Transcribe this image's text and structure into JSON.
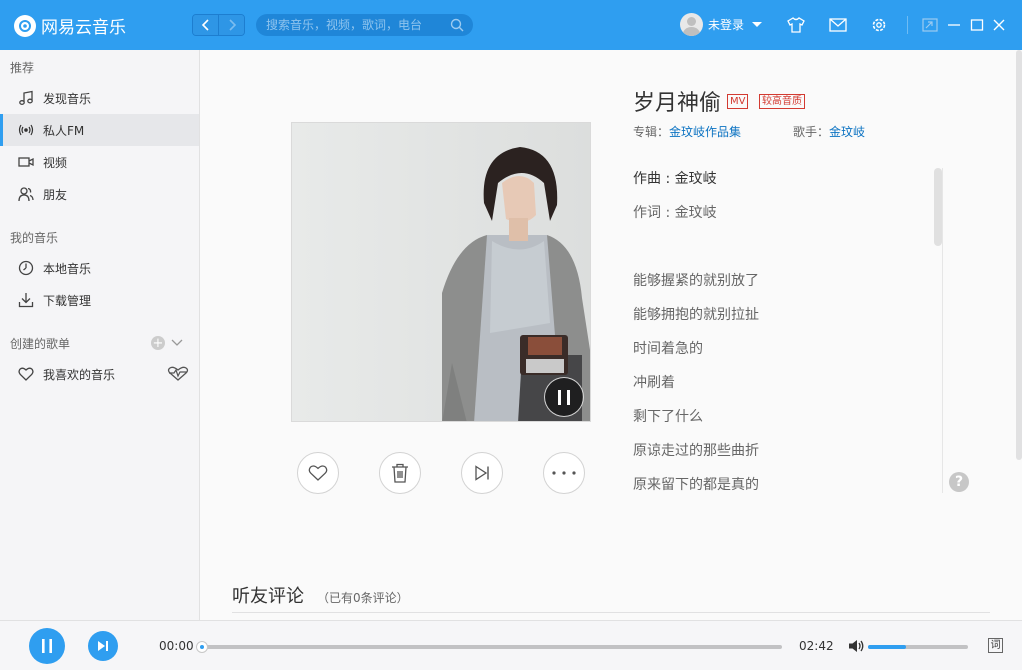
{
  "app": {
    "name": "网易云音乐"
  },
  "search": {
    "placeholder": "搜索音乐，视频，歌词，电台"
  },
  "user": {
    "name": "未登录"
  },
  "sidebar": {
    "section_recommend": "推荐",
    "items_recommend": [
      {
        "label": "发现音乐",
        "icon": "music-note-icon"
      },
      {
        "label": "私人FM",
        "icon": "radio-icon",
        "active": true
      },
      {
        "label": "视频",
        "icon": "video-icon"
      },
      {
        "label": "朋友",
        "icon": "friends-icon"
      }
    ],
    "section_my_music": "我的音乐",
    "items_my_music": [
      {
        "label": "本地音乐",
        "icon": "local-music-icon"
      },
      {
        "label": "下载管理",
        "icon": "download-icon"
      }
    ],
    "section_playlists": "创建的歌单",
    "items_playlists": [
      {
        "label": "我喜欢的音乐",
        "icon": "heart-icon"
      }
    ]
  },
  "song": {
    "title": "岁月神偷",
    "tag_mv": "MV",
    "tag_quality": "较高音质",
    "album_label": "专辑：",
    "album": "金玟岐作品集",
    "artist_label": "歌手：",
    "artist": "金玟岐"
  },
  "lyrics": [
    "作曲 : 金玟岐",
    "作词 : 金玟岐",
    "",
    "能够握紧的就别放了",
    "能够拥抱的就别拉扯",
    "时间着急的",
    "冲刷着",
    "剩下了什么",
    "原谅走过的那些曲折",
    "原来留下的都是真的"
  ],
  "comments": {
    "title": "听友评论",
    "count_text": "（已有0条评论）"
  },
  "player": {
    "current_time": "00:00",
    "total_time": "02:42",
    "progress": 0.0,
    "volume": 0.38,
    "lyric_button": "词"
  },
  "colors": {
    "accent": "#2f9ef0",
    "tag_red": "#d33a31",
    "link": "#0c73c2"
  }
}
